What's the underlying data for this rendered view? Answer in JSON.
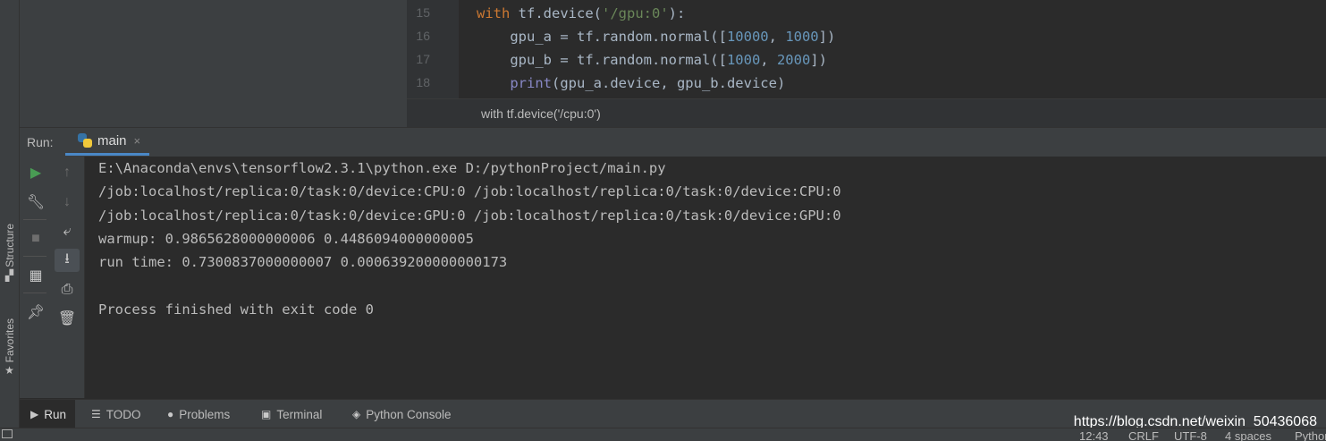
{
  "side_tabs": {
    "structure": "Structure",
    "favorites": "Favorites"
  },
  "editor": {
    "line_numbers": [
      "15",
      "16",
      "17",
      "18"
    ],
    "lines": [
      [
        {
          "t": "with ",
          "c": "kw"
        },
        {
          "t": "tf.device(",
          "c": ""
        },
        {
          "t": "'/gpu:0'",
          "c": "str"
        },
        {
          "t": "):",
          "c": ""
        }
      ],
      [
        {
          "t": "    gpu_a = tf.random.normal([",
          "c": ""
        },
        {
          "t": "10000",
          "c": "num"
        },
        {
          "t": ", ",
          "c": ""
        },
        {
          "t": "1000",
          "c": "num"
        },
        {
          "t": "])",
          "c": ""
        }
      ],
      [
        {
          "t": "    gpu_b = tf.random.normal([",
          "c": ""
        },
        {
          "t": "1000",
          "c": "num"
        },
        {
          "t": ", ",
          "c": ""
        },
        {
          "t": "2000",
          "c": "num"
        },
        {
          "t": "])",
          "c": ""
        }
      ],
      [
        {
          "t": "    ",
          "c": ""
        },
        {
          "t": "print",
          "c": "builtin"
        },
        {
          "t": "(gpu_a.device, gpu_b.device)",
          "c": ""
        }
      ]
    ],
    "breadcrumb": "with tf.device('/cpu:0')"
  },
  "run_window": {
    "label": "Run:",
    "tab_name": "main",
    "close_icon": "×"
  },
  "console": {
    "lines": [
      "E:\\Anaconda\\envs\\tensorflow2.3.1\\python.exe D:/pythonProject/main.py",
      "/job:localhost/replica:0/task:0/device:CPU:0 /job:localhost/replica:0/task:0/device:CPU:0",
      "/job:localhost/replica:0/task:0/device:GPU:0 /job:localhost/replica:0/task:0/device:GPU:0",
      "warmup: 0.9865628000000006 0.4486094000000005",
      "run time: 0.7300837000000007 0.000639200000000173",
      "",
      "Process finished with exit code 0"
    ]
  },
  "bottom_tabs": {
    "run": "Run",
    "todo": "TODO",
    "problems": "Problems",
    "terminal": "Terminal",
    "python_console": "Python Console"
  },
  "watermark": "https://blog.csdn.net/weixin_50436068",
  "status_bar": {
    "position": "12:43",
    "line_sep": "CRLF",
    "encoding": "UTF-8",
    "indent": "4 spaces",
    "interpreter": "Python"
  },
  "colors": {
    "accent": "#4a88c7",
    "run_green": "#499c54",
    "keyword": "#cc7832",
    "string": "#6a8759",
    "number": "#6897bb"
  }
}
